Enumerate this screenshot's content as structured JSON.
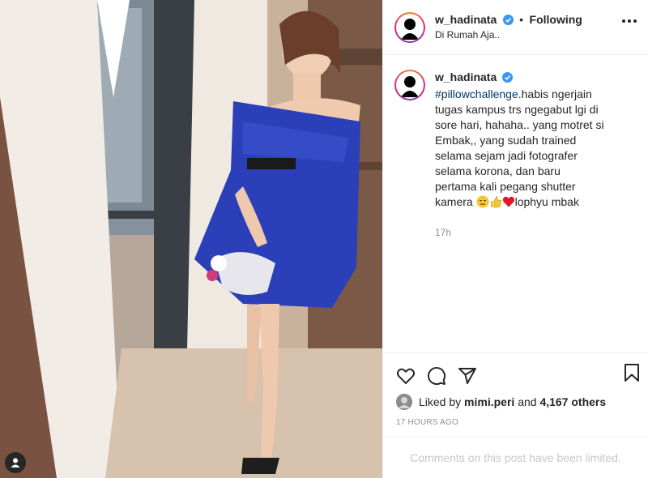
{
  "header": {
    "username": "w_hadinata",
    "separator": "•",
    "follow_label": "Following",
    "location": "Di Rumah Aja.."
  },
  "caption": {
    "username": "w_hadinata",
    "hashtag": "#pillowchallenge",
    "text": ".habis ngerjain tugas kampus trs ngegabut lgi di sore hari, hahaha.. yang motret si Embak,, yang sudah trained selama sejam jadi fotografer selama korona, dan baru pertama kali pegang shutter kamera",
    "ending": "lophyu mbak",
    "time": "17h"
  },
  "likes": {
    "prefix": "Liked by",
    "liker": "mimi.peri",
    "conj": "and",
    "others": "4,167 others"
  },
  "timestamp": "17 HOURS AGO",
  "comments_notice": "Comments on this post have been limited.",
  "icons": {
    "like": "heart-icon",
    "comment": "comment-icon",
    "share": "share-icon",
    "save": "bookmark-icon",
    "tag": "user-tag-icon",
    "verified": "verified-badge-icon",
    "more": "more-options-icon"
  },
  "colors": {
    "verified": "#3897f0",
    "hashtag": "#00376b",
    "dress": "#2a3fb8",
    "muted": "#8e8e8e"
  }
}
